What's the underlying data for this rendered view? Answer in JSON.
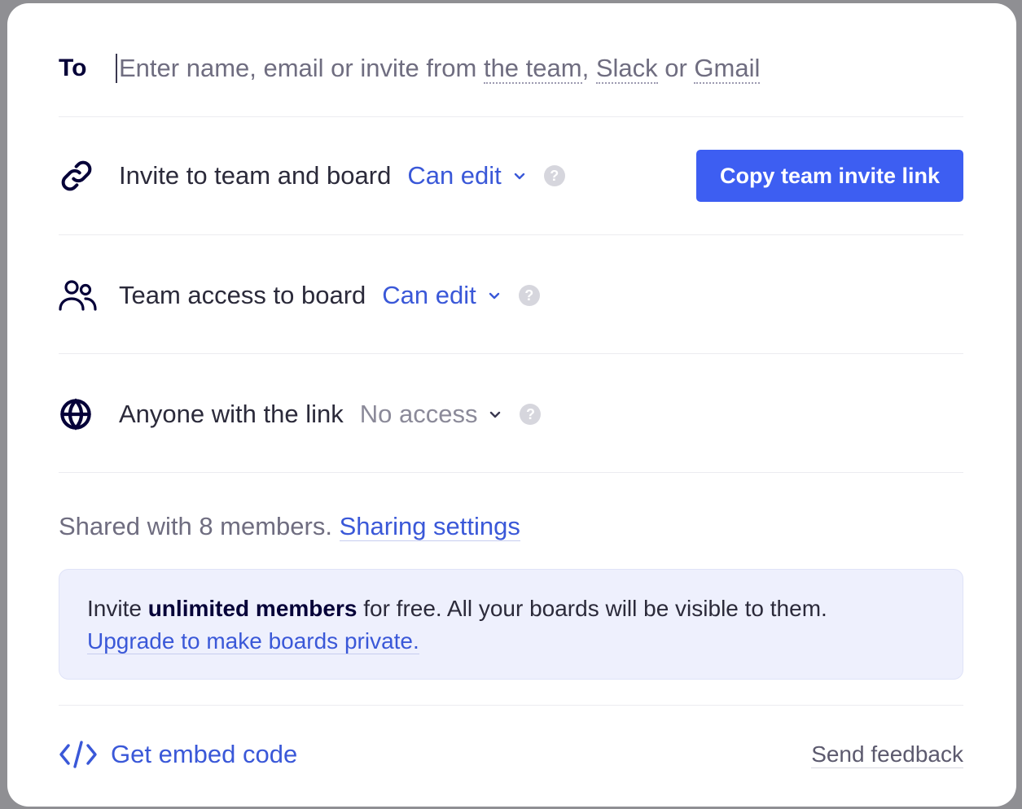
{
  "to": {
    "label": "To",
    "placeholder_prefix": "Enter name, email or invite from ",
    "link_team": "the team",
    "sep1": ", ",
    "link_slack": "Slack",
    "sep2": " or ",
    "link_gmail": "Gmail"
  },
  "invite_row": {
    "icon": "link-icon",
    "label": "Invite to team and board",
    "permission": "Can edit",
    "help": "?",
    "copy_button": "Copy team invite link"
  },
  "team_row": {
    "icon": "team-icon",
    "label": "Team access to board",
    "permission": "Can edit",
    "help": "?"
  },
  "link_row": {
    "icon": "globe-icon",
    "label": "Anyone with the link",
    "permission": "No access",
    "help": "?"
  },
  "shared": {
    "text": "Shared with 8 members. ",
    "link": "Sharing settings"
  },
  "info": {
    "prefix": "Invite ",
    "bold": "unlimited members",
    "suffix": " for free. All your boards will be visible to them.",
    "link": "Upgrade to make boards private."
  },
  "footer": {
    "embed_icon": "code-icon",
    "embed_label": "Get embed code",
    "feedback": "Send feedback"
  },
  "colors": {
    "accent": "#3d5ef2",
    "link": "#3a58d8",
    "info_bg": "#eef0fd",
    "text_dark": "#050038"
  }
}
